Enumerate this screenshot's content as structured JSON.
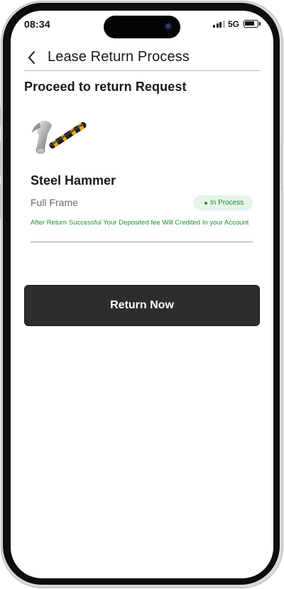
{
  "status_bar": {
    "time": "08:34",
    "network": "5G",
    "signal_bars_active": 3,
    "signal_bars_total": 4
  },
  "header": {
    "back_icon": "chevron-left-icon",
    "title": "Lease Return Process"
  },
  "content": {
    "section_title": "Proceed to return Request",
    "item": {
      "image_icon": "hammer-image",
      "name": "Steel Hammer",
      "variant": "Full Frame",
      "status": "In Process",
      "note": "After Return Successful Your Deposited fee Will Credited In your Account"
    }
  },
  "actions": {
    "primary_label": "Return Now"
  },
  "colors": {
    "primary_button": "#2d2d2d",
    "status_text": "#1f8a3a",
    "status_background": "#e6f4e9",
    "note_text": "#1b8f2e"
  }
}
